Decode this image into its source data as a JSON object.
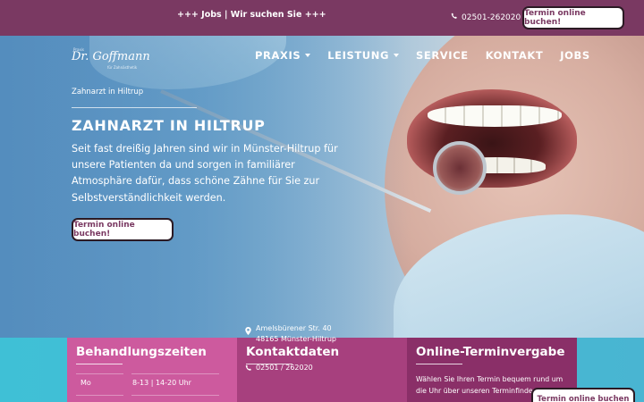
{
  "topbar": {
    "jobs_text": "+++ Jobs | Wir suchen Sie +++",
    "phone": "02501-262020",
    "cta_label": "Termin online buchen!"
  },
  "logo": {
    "prefix": "Praxis",
    "name": "Dr. Goffmann",
    "sub": "für Zahnästhetik"
  },
  "nav": {
    "items": [
      {
        "label": "PRAXIS",
        "dropdown": true
      },
      {
        "label": "LEISTUNG",
        "dropdown": true
      },
      {
        "label": "SERVICE",
        "dropdown": false
      },
      {
        "label": "KONTAKT",
        "dropdown": false
      },
      {
        "label": "JOBS",
        "dropdown": false
      }
    ]
  },
  "hero": {
    "breadcrumb": "Zahnarzt in Hiltrup",
    "title": "ZAHNARZT IN HILTRUP",
    "lead": "Seit fast dreißig Jahren sind wir in Münster-Hiltrup für unsere Patienten da und sorgen in familiärer Atmosphäre dafür, dass schöne Zähne für Sie zur Selbstverständlichkeit werden.",
    "cta_label": "Termin online buchen!"
  },
  "cards": {
    "hours": {
      "title": "Behandlungszeiten",
      "rows": [
        {
          "day": "Mo",
          "time": "8-13 | 14-20 Uhr"
        }
      ]
    },
    "contact": {
      "title": "Kontaktdaten",
      "address_line1": "Amelsbürener Str. 40",
      "address_line2": "48165 Münster-Hiltrup",
      "phone": "02501 / 262020"
    },
    "online": {
      "title": "Online-Terminvergabe",
      "text": "Wählen Sie Ihren Termin bequem rund um die Uhr über unseren Terminfinder"
    }
  },
  "floating_cta": {
    "label": "Termin online buchen"
  },
  "colors": {
    "brand_purple": "#7a3962",
    "card_pink": "#cd5a9e",
    "card_magenta": "#a7407e",
    "card_plum": "#8a2f68",
    "accent_cyan": "#3fc0d6"
  },
  "icons": [
    "phone-icon",
    "map-pin-icon",
    "caret-down-icon"
  ]
}
